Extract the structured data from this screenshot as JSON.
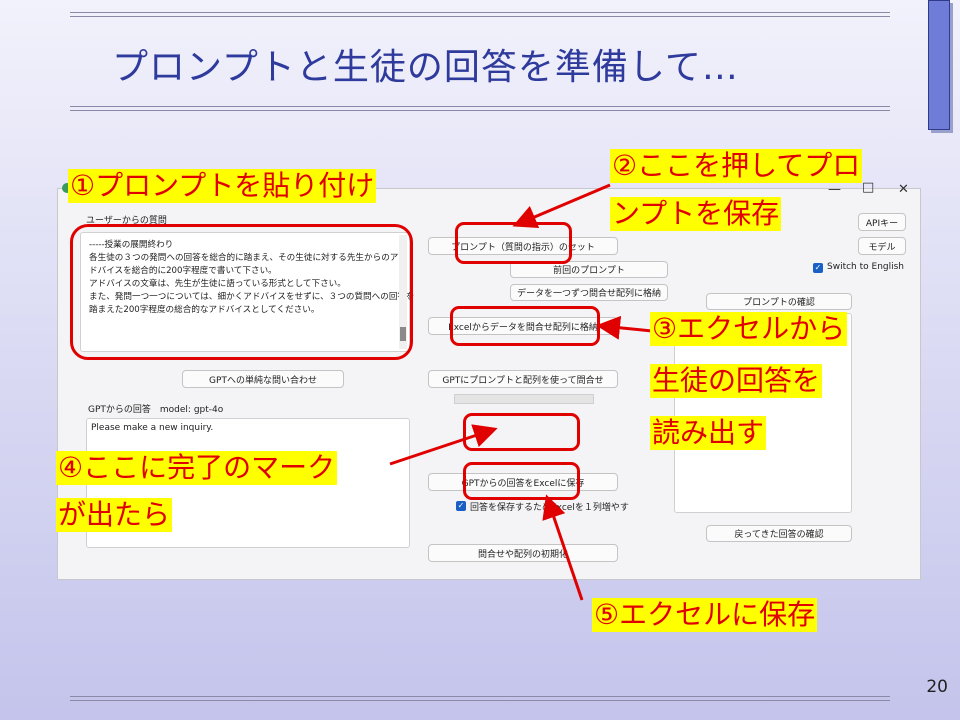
{
  "slide": {
    "title": "プロンプトと生徒の回答を準備して…",
    "page_number": "20"
  },
  "window": {
    "controls": {
      "minimize": "—",
      "maximize": "□",
      "close": "✕"
    },
    "user_question_label": "ユーザーからの質問",
    "prompt_lines": [
      "-----授業の展開終わり",
      "",
      "各生徒の３つの発問への回答を総合的に踏まえ、その生徒に対する先生からのア",
      "ドバイスを総合的に200字程度で書いて下さい。",
      "",
      "アドバイスの文章は、先生が生徒に語っている形式として下さい。",
      "",
      "また、発問一つ一つについては、細かくアドバイスをせずに、３つの質問への回答を",
      "踏まえた200字程度の総合的なアドバイスとしてください。"
    ],
    "buttons": {
      "prompt_set": "プロンプト（質問の指示）のセット",
      "previous_prompt": "前回のプロンプト",
      "store_one_by_one": "データを一つずつ問合せ配列に格納",
      "excel_store": "Excelからデータを問合せ配列に格納",
      "simple_inquiry": "GPTへの単純な問い合わせ",
      "gpt_inquiry_array": "GPTにプロンプトと配列を使って問合せ",
      "save_excel": "GPTからの回答をExcelに保存",
      "init_array": "問合せや配列の初期化",
      "api_key": "APIキー",
      "model": "モデル",
      "confirm_prompt": "プロンプトの確認",
      "confirm_returned": "戻ってきた回答の確認"
    },
    "switch_english_label": "Switch to English",
    "gpt_answer_label": "GPTからの回答　model: gpt-4o",
    "gpt_answer_text": "Please make a new inquiry.",
    "add_column_label": "回答を保存するためExcelを１列増やす"
  },
  "annotations": {
    "a1": "①プロンプトを貼り付け",
    "a2_line1": "②ここを押してプロ",
    "a2_line2": "ンプトを保存",
    "a3_line1": "③エクセルから",
    "a3_line2": "生徒の回答を",
    "a3_line3": "読み出す",
    "a4_line1": "④ここに完了のマーク",
    "a4_line2": "が出たら",
    "a5": "⑤エクセルに保存"
  },
  "colors": {
    "title": "#2e3a9c",
    "annotation_text": "#e00000",
    "annotation_bg": "#ffff00",
    "checkbox": "#1a5fc4"
  }
}
